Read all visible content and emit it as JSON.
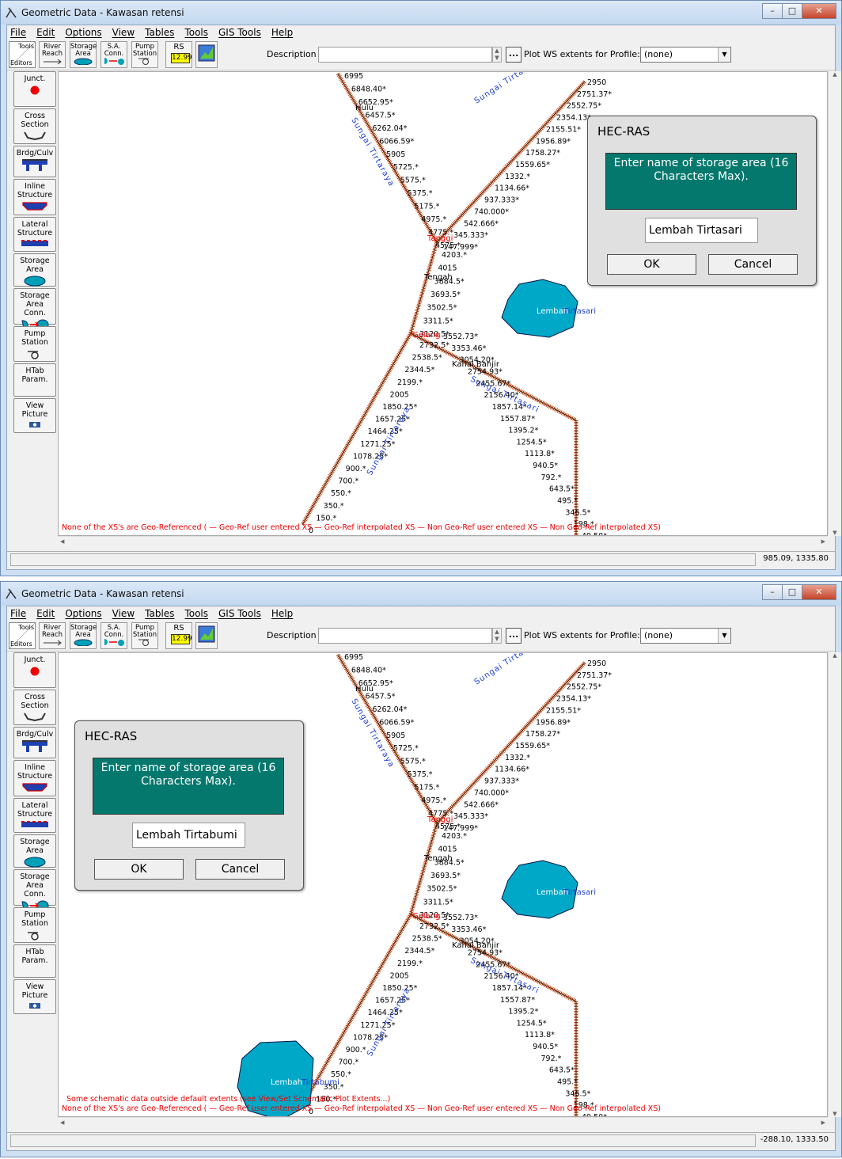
{
  "windows": [
    {
      "title": "Geometric Data - Kawasan retensi",
      "menu": [
        "File",
        "Edit",
        "Options",
        "View",
        "Tables",
        "Tools",
        "GIS Tools",
        "Help"
      ],
      "toolbar": {
        "tools_label": "Tools",
        "editors_label": "Editors",
        "river_reach": "River Reach",
        "storage_area": "Storage Area",
        "sa_conn": "S.A. Conn.",
        "pump_station": "Pump Station",
        "rs_label": "RS",
        "rs_value": "12.99",
        "description_label": "Description :",
        "plot_label": "Plot WS extents for Profile:",
        "plot_value": "(none)"
      },
      "sidebar": [
        "Junct.",
        "Cross Section",
        "Brdg/Culv",
        "Inline Structure",
        "Lateral Structure",
        "Storage Area",
        "Storage Area Conn.",
        "Pump Station",
        "HTab Param.",
        "View Picture"
      ],
      "status_coords": "985.09, 1335.80",
      "legend_line": "None of the XS's are Geo-Referenced ( — Geo-Ref user entered XS — Geo-Ref interpolated XS — Non Geo-Ref user entered XS — Non Geo-Ref interpolated XS)",
      "extents_note": "",
      "dialog": {
        "title": "HEC-RAS",
        "message": "Enter name of storage area (16 Characters Max).",
        "value": "Lembah Tirtasari",
        "ok": "OK",
        "cancel": "Cancel"
      },
      "storage_areas": [
        "Lembah Tirtasari"
      ]
    },
    {
      "title": "Geometric Data - Kawasan retensi",
      "menu": [
        "File",
        "Edit",
        "Options",
        "View",
        "Tables",
        "Tools",
        "GIS Tools",
        "Help"
      ],
      "toolbar": {
        "tools_label": "Tools",
        "editors_label": "Editors",
        "river_reach": "River Reach",
        "storage_area": "Storage Area",
        "sa_conn": "S.A. Conn.",
        "pump_station": "Pump Station",
        "rs_label": "RS",
        "rs_value": "12.99",
        "description_label": "Description :",
        "plot_label": "Plot WS extents for Profile:",
        "plot_value": "(none)"
      },
      "sidebar": [
        "Junct.",
        "Cross Section",
        "Brdg/Culv",
        "Inline Structure",
        "Lateral Structure",
        "Storage Area",
        "Storage Area Conn.",
        "Pump Station",
        "HTab Param.",
        "View Picture"
      ],
      "status_coords": "-288.10, 1333.50",
      "legend_line": "None of the XS's are Geo-Referenced ( — Geo-Ref user entered XS — Geo-Ref interpolated XS — Non Geo-Ref user entered XS — Non Geo-Ref interpolated XS)",
      "extents_note": "Some schematic data outside default extents (see View/Set Schematic Plot Extents...)",
      "dialog": {
        "title": "HEC-RAS",
        "message": "Enter name of storage area (16 Characters Max).",
        "value": "Lembah Tirtabumi",
        "ok": "OK",
        "cancel": "Cancel"
      },
      "storage_areas": [
        "Lembah Tirtasari",
        "Lembah Tirtabumi"
      ]
    }
  ],
  "schematic": {
    "reach_labels": [
      "Sungai Tirtaraya",
      "Sungai Tirtaraya",
      "Sungai Tirtaraya",
      "Sungai Tirtasari"
    ],
    "junctions": [
      "Hulu",
      "Tanggi",
      "Tengah",
      "Gelang",
      "Kanal Banjir"
    ],
    "upper_left_xs": [
      "6995",
      "6848.40*",
      "6652.95*",
      "6457.5*",
      "6262.04*",
      "6066.59*",
      "5905",
      "5725.*",
      "5575.*",
      "5375.*",
      "5175.*",
      "4975.*",
      "4775.*",
      "4575.*"
    ],
    "upper_right_xs": [
      "2950",
      "2751.37*",
      "2552.75*",
      "2354.13*",
      "2155.51*",
      "1956.89*",
      "1758.27*",
      "1559.65*",
      "1332.*",
      "1134.66*",
      "937.333*",
      "740.000*",
      "542.666*",
      "345.333*",
      "147.999*"
    ],
    "middle_xs": [
      "4203.*",
      "4015",
      "3884.5*",
      "3693.5*",
      "3502.5*",
      "3311.5*",
      "3120.5*"
    ],
    "lower_left_xs": [
      "2732.5*",
      "2538.5*",
      "2344.5*",
      "2199.*",
      "2005",
      "1850.25*",
      "1657.25*",
      "1464.25*",
      "1271.25*",
      "1078.25*",
      "900.*",
      "700.*",
      "550.*",
      "350.*",
      "150.*",
      "0"
    ],
    "lower_right_xs": [
      "3552.73*",
      "3353.46*",
      "3054.20*",
      "2754.93*",
      "2455.67*",
      "2156.40*",
      "1857.14*",
      "1557.87*",
      "1395.2*",
      "1254.5*",
      "1113.8*",
      "940.5*",
      "792.*",
      "643.5*",
      "495.*",
      "346.5*",
      "198.*",
      "49.50*"
    ]
  }
}
